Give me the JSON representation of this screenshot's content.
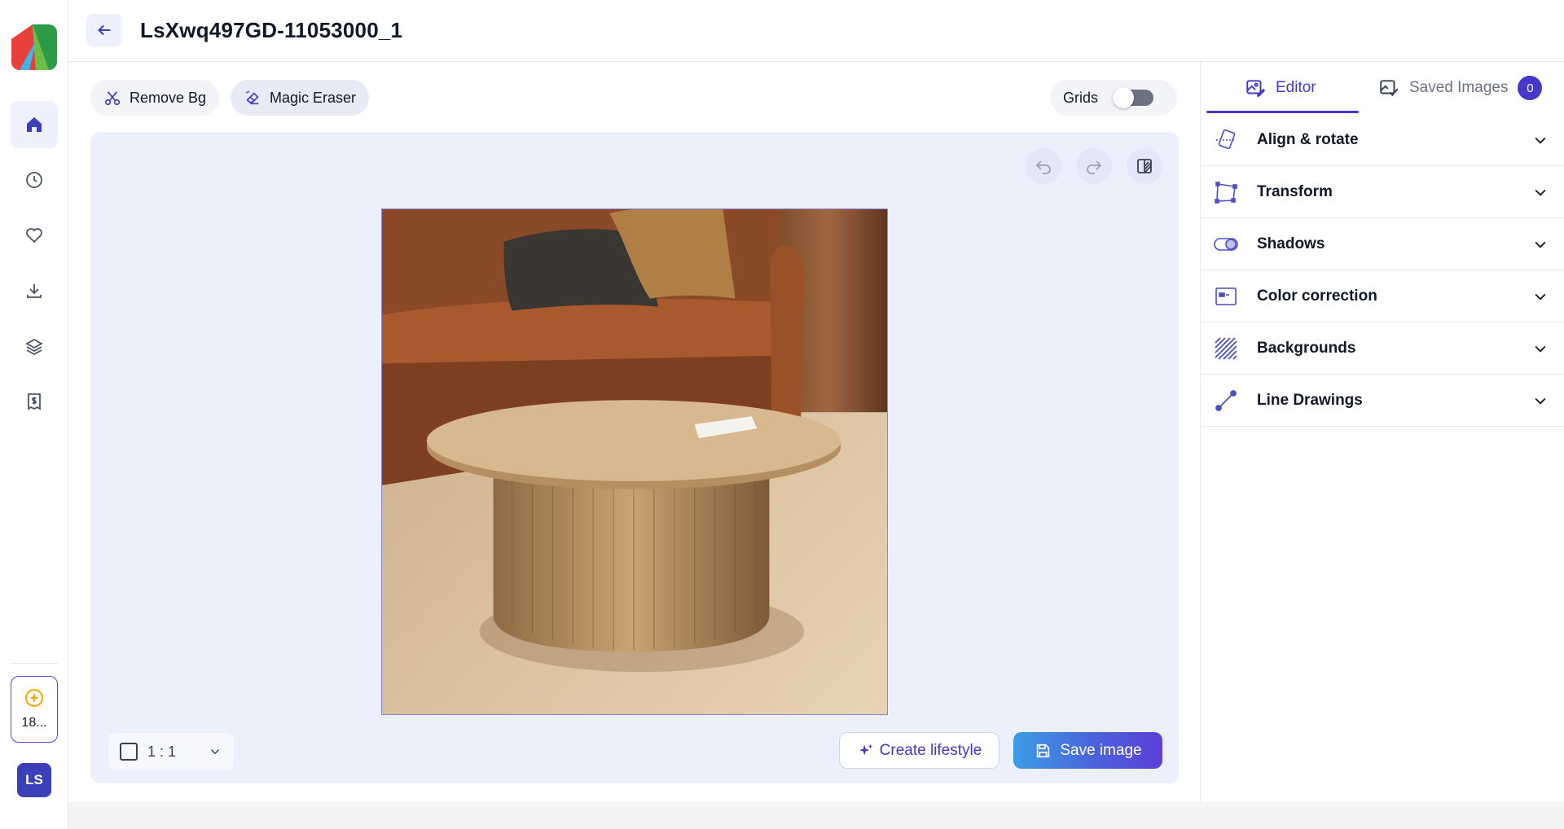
{
  "header": {
    "title": "LsXwq497GD-11053000_1"
  },
  "toolbar": {
    "remove_bg": "Remove Bg",
    "magic_eraser": "Magic Eraser",
    "grids_label": "Grids",
    "grids_on": false
  },
  "rail": {
    "credits": "18...",
    "avatar": "LS"
  },
  "canvas": {
    "ratio": "1 : 1",
    "create_lifestyle": "Create lifestyle",
    "save_image": "Save image"
  },
  "panel": {
    "tabs": [
      {
        "label": "Editor",
        "active": true
      },
      {
        "label": "Saved Images",
        "count": "0"
      }
    ],
    "sections": [
      {
        "label": "Align & rotate",
        "icon": "align-rotate-icon"
      },
      {
        "label": "Transform",
        "icon": "transform-icon"
      },
      {
        "label": "Shadows",
        "icon": "shadows-icon"
      },
      {
        "label": "Color correction",
        "icon": "color-correction-icon"
      },
      {
        "label": "Backgrounds",
        "icon": "backgrounds-icon"
      },
      {
        "label": "Line Drawings",
        "icon": "line-drawings-icon"
      }
    ]
  },
  "colors": {
    "accent": "#4338ca",
    "canvas_bg": "#eceffc",
    "save_gradient_start": "#3b9de6",
    "save_gradient_end": "#5a3fd6"
  }
}
